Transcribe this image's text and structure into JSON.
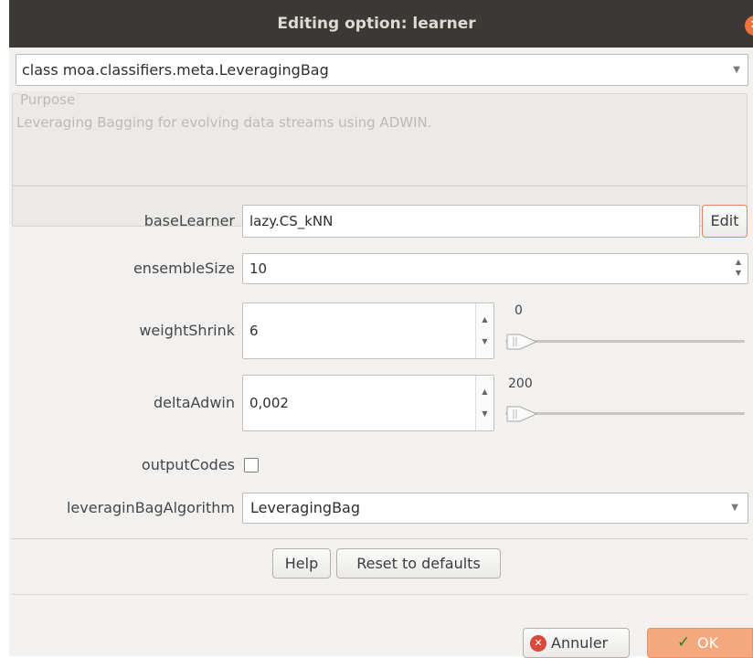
{
  "window": {
    "title": "Editing option: learner",
    "close_icon": "close-icon"
  },
  "class_selector": {
    "value": "class moa.classifiers.meta.LeveragingBag"
  },
  "purpose": {
    "legend": "Purpose",
    "text": "Leveraging Bagging for evolving data streams using ADWIN."
  },
  "options": {
    "baseLearner": {
      "label": "baseLearner",
      "value": "lazy.CS_kNN",
      "edit_label": "Edit"
    },
    "ensembleSize": {
      "label": "ensembleSize",
      "value": "10"
    },
    "weightShrink": {
      "label": "weightShrink",
      "value": "6",
      "slider_value": "0",
      "slider_fraction": 0
    },
    "deltaAdwin": {
      "label": "deltaAdwin",
      "value": "0,002",
      "slider_value": "200",
      "slider_fraction": 0
    },
    "outputCodes": {
      "label": "outputCodes",
      "checked": false
    },
    "leveraginBagAlgorithm": {
      "label": "leveraginBagAlgorithm",
      "value": "LeveragingBag"
    }
  },
  "footer": {
    "help_label": "Help",
    "reset_label": "Reset to defaults",
    "cancel_label": "Annuler",
    "ok_label": "OK"
  },
  "colors": {
    "titlebar": "#3a3935",
    "accent": "#f0733a",
    "ok_button": "#f5a77e",
    "window_bg": "#f2f1f0"
  }
}
